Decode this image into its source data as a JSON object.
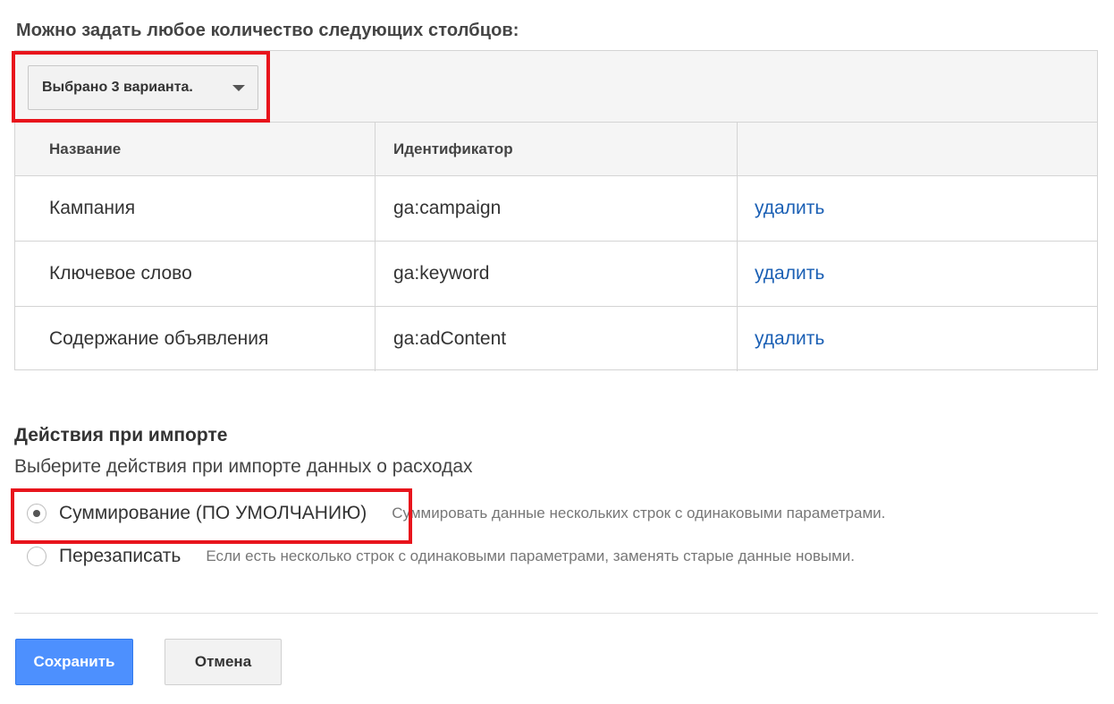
{
  "columns_section": {
    "heading": "Можно задать любое количество следующих столбцов:",
    "select_label": "Выбрано 3 варианта.",
    "table": {
      "headers": [
        "Название",
        "Идентификатор",
        ""
      ],
      "rows": [
        {
          "name": "Кампания",
          "id": "ga:campaign",
          "action": "удалить"
        },
        {
          "name": "Ключевое слово",
          "id": "ga:keyword",
          "action": "удалить"
        },
        {
          "name": "Содержание объявления",
          "id": "ga:adContent",
          "action": "удалить"
        }
      ]
    }
  },
  "import_section": {
    "title": "Действия при импорте",
    "subtitle": "Выберите действия при импорте данных о расходах",
    "options": [
      {
        "label": "Суммирование (ПО УМОЛЧАНИЮ)",
        "description": "Суммировать данные нескольких строк с одинаковыми параметрами.",
        "checked": true
      },
      {
        "label": "Перезаписать",
        "description": "Если есть несколько строк с одинаковыми параметрами, заменять старые данные новыми.",
        "checked": false
      }
    ]
  },
  "buttons": {
    "save": "Сохранить",
    "cancel": "Отмена"
  },
  "colors": {
    "highlight": "#e8141c",
    "link": "#1a5fb4",
    "primary_button": "#4d90fe"
  },
  "icons": {
    "dropdown": "caret-down-icon"
  }
}
